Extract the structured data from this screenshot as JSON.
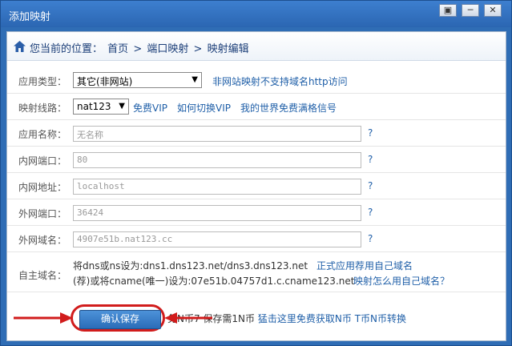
{
  "window": {
    "title": "添加映射",
    "min": "▣",
    "max": "─",
    "close": "✕"
  },
  "breadcrumb": {
    "prefix": "您当前的位置：",
    "items": [
      "首页",
      ">",
      "端口映射",
      ">",
      "映射编辑"
    ]
  },
  "form": {
    "app_type": {
      "label": "应用类型：",
      "value": "其它(非网站)",
      "note": "非网站映射不支持域名http访问"
    },
    "route": {
      "label": "映射线路：",
      "value": "nat123",
      "links": [
        "免费VIP",
        "如何切换VIP",
        "我的世界免费满格信号"
      ]
    },
    "app_name": {
      "label": "应用名称：",
      "placeholder": "无名称",
      "help": "?"
    },
    "lan_port": {
      "label": "内网端口：",
      "value": "80",
      "help": "?"
    },
    "lan_addr": {
      "label": "内网地址：",
      "value": "localhost",
      "help": "?"
    },
    "wan_port": {
      "label": "外网端口：",
      "value": "36424",
      "help": "?"
    },
    "wan_domain": {
      "label": "外网域名：",
      "value": "4907e51b.nat123.cc",
      "help": "?"
    },
    "custom_domain": {
      "label": "自主域名：",
      "line1": "将dns或ns设为:dns1.dns123.net/dns3.dns123.net",
      "line1_link": "正式应用荐用自己域名",
      "line2": "(荐)或将cname(唯一)设为:07e51b.04757d1.c.cname123.net",
      "line2_link": "映射怎么用自己域名？"
    }
  },
  "footer": {
    "save": "确认保存",
    "text_a": "免N币7 保存需1N币",
    "link": "猛击这里免费获取N币",
    "text_b": "T币N币转换"
  },
  "colors": {
    "accent": "#2a6cb8",
    "highlight": "#d11c1c"
  }
}
